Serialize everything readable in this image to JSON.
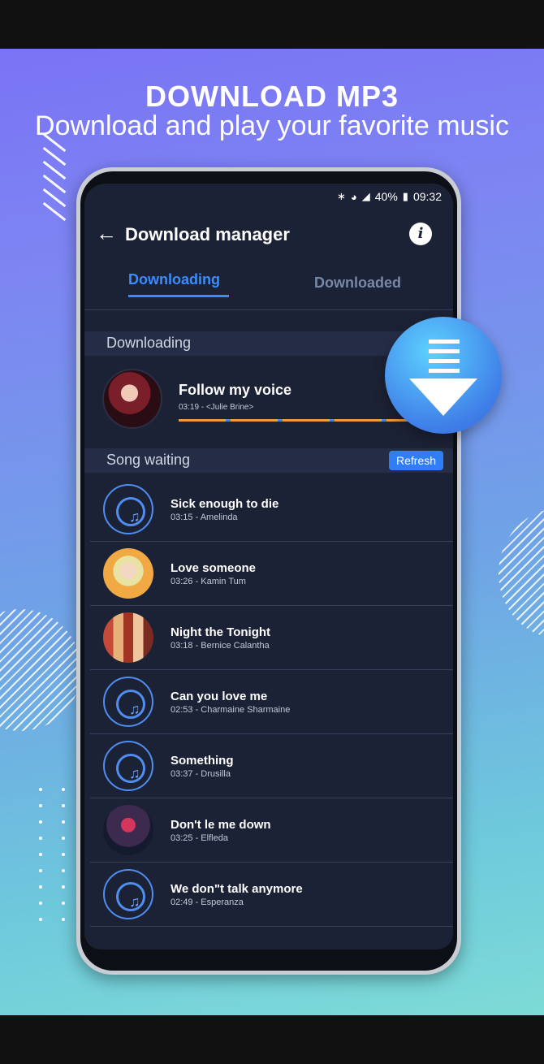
{
  "promo": {
    "headline": "DOWNLOAD MP3",
    "subhead": "Download and play your favorite music"
  },
  "status_bar": {
    "icons": [
      "bluetooth-icon",
      "wifi-icon",
      "signal-icon",
      "battery-icon"
    ],
    "battery": "40%",
    "time": "09:32"
  },
  "header": {
    "title": "Download manager",
    "info_icon_glyph": "i"
  },
  "tabs": [
    {
      "label": "Downloading",
      "active": true
    },
    {
      "label": "Downloaded",
      "active": false
    }
  ],
  "downloading_section": {
    "label": "Downloading",
    "item": {
      "title": "Follow my voice",
      "subtitle": "03:19 - <Julie Brine>"
    }
  },
  "waiting_section": {
    "label": "Song waiting",
    "refresh_label": "Refresh",
    "songs": [
      {
        "title": "Sick enough to die",
        "subtitle": "03:15 - Amelinda",
        "art": "disc"
      },
      {
        "title": "Love someone",
        "subtitle": "03:26 - Kamin Tum",
        "art": "photo1"
      },
      {
        "title": "Night the Tonight",
        "subtitle": "03:18 - Bernice Calantha",
        "art": "photo2"
      },
      {
        "title": "Can you love me",
        "subtitle": "02:53 - Charmaine Sharmaine",
        "art": "disc"
      },
      {
        "title": "Something",
        "subtitle": "03:37 - Drusilla",
        "art": "disc"
      },
      {
        "title": "Don't le me down",
        "subtitle": "03:25 - Elfleda",
        "art": "photo3"
      },
      {
        "title": "We don\"t talk anymore",
        "subtitle": "02:49 - Esperanza",
        "art": "disc"
      }
    ]
  },
  "colors": {
    "accent": "#3b8cff",
    "screen_bg": "#1c2235",
    "progress": "#f09a3e"
  }
}
